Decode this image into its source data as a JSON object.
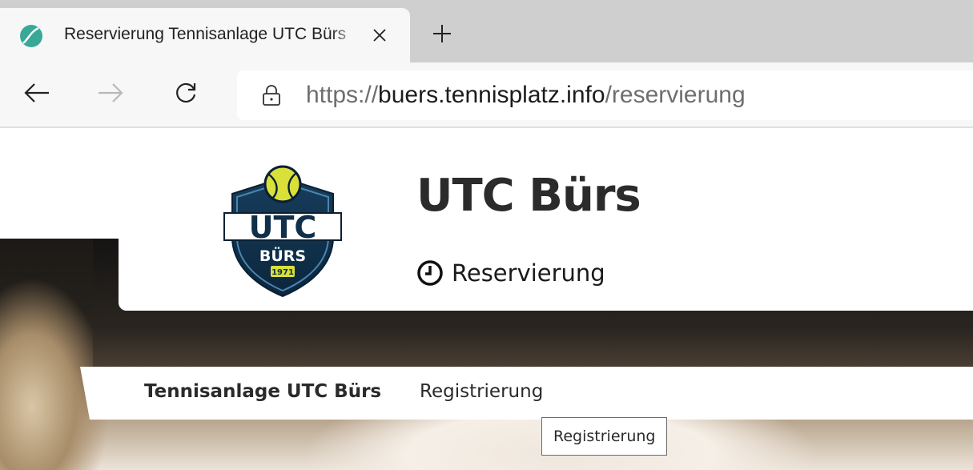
{
  "browser": {
    "tab": {
      "title": "Reservierung Tennisanlage UTC Bürs",
      "favicon": "tennis-ball-icon",
      "close_icon": "close-icon"
    },
    "new_tab_icon": "plus-icon",
    "nav": {
      "back_icon": "arrow-left-icon",
      "forward_icon": "arrow-right-icon",
      "reload_icon": "reload-icon"
    },
    "address": {
      "lock_icon": "lock-icon",
      "scheme": "https://",
      "host": "buers.tennisplatz.info",
      "path": "/reservierung"
    }
  },
  "header": {
    "logo": {
      "line1": "UTC",
      "line2": "BÜRS",
      "year": "1971"
    },
    "title": "UTC Bürs",
    "subtitle": "Reservierung",
    "subtitle_icon": "clock-icon"
  },
  "nav": {
    "items": [
      {
        "label": "Tennisanlage UTC Bürs"
      },
      {
        "label": "Registrierung"
      }
    ]
  },
  "tooltip": {
    "text": "Registrierung"
  },
  "colors": {
    "tab_strip": "#cfcfcf",
    "toolbar": "#f7f7f7",
    "logo_navy": "#0f2f4a",
    "logo_yellow": "#d9e03a",
    "title_text": "#2b2b2b"
  }
}
